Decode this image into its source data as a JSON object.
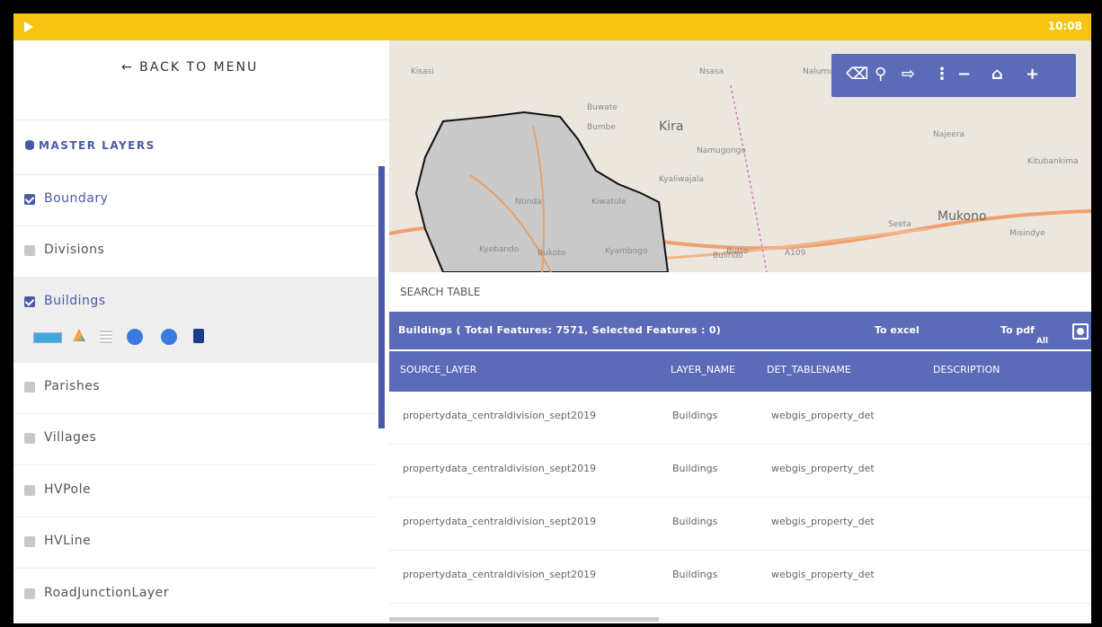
{
  "status": {
    "time": "10:08"
  },
  "sidebar": {
    "back_label": "← BACK TO MENU",
    "master_label": "MASTER LAYERS",
    "layers": [
      {
        "label": "Boundary",
        "checked": true
      },
      {
        "label": "Divisions",
        "checked": false
      },
      {
        "label": "Buildings",
        "checked": true
      },
      {
        "label": "Parishes",
        "checked": false
      },
      {
        "label": "Villages",
        "checked": false
      },
      {
        "label": "HVPole",
        "checked": false
      },
      {
        "label": "HVLine",
        "checked": false
      },
      {
        "label": "RoadJunctionLayer",
        "checked": false
      }
    ]
  },
  "map": {
    "labels": [
      "Kisasi",
      "Buwate",
      "Kira",
      "Bumbe",
      "Namugongo",
      "Nalumunye",
      "Kyaliwajala",
      "Mukono",
      "Seeta",
      "Bulindo",
      "Kyambogo",
      "Bukoto",
      "Kyebando",
      "Ntinda",
      "Najeera",
      "Kiwatule",
      "Nsasa",
      "Butto",
      "A109",
      "Misindye",
      "Kitubankima"
    ],
    "toolbar": [
      "eraser-icon",
      "pin-icon",
      "exit-icon",
      "more-icon",
      "zoom-out-icon",
      "home-icon",
      "zoom-in-icon"
    ]
  },
  "search": {
    "placeholder": "SEARCH TABLE"
  },
  "table": {
    "title": "Buildings ( Total Features: 7571, Selected Features : 0)",
    "to_excel": "To excel",
    "to_pdf": "To pdf",
    "all": "All",
    "columns": [
      "SOURCE_LAYER",
      "LAYER_NAME",
      "DET_TABLENAME",
      "DESCRIPTION"
    ],
    "rows": [
      [
        "propertydata_centraldivision_sept2019",
        "Buildings",
        "webgis_property_det",
        ""
      ],
      [
        "propertydata_centraldivision_sept2019",
        "Buildings",
        "webgis_property_det",
        ""
      ],
      [
        "propertydata_centraldivision_sept2019",
        "Buildings",
        "webgis_property_det",
        ""
      ],
      [
        "propertydata_centraldivision_sept2019",
        "Buildings",
        "webgis_property_det",
        ""
      ]
    ]
  }
}
